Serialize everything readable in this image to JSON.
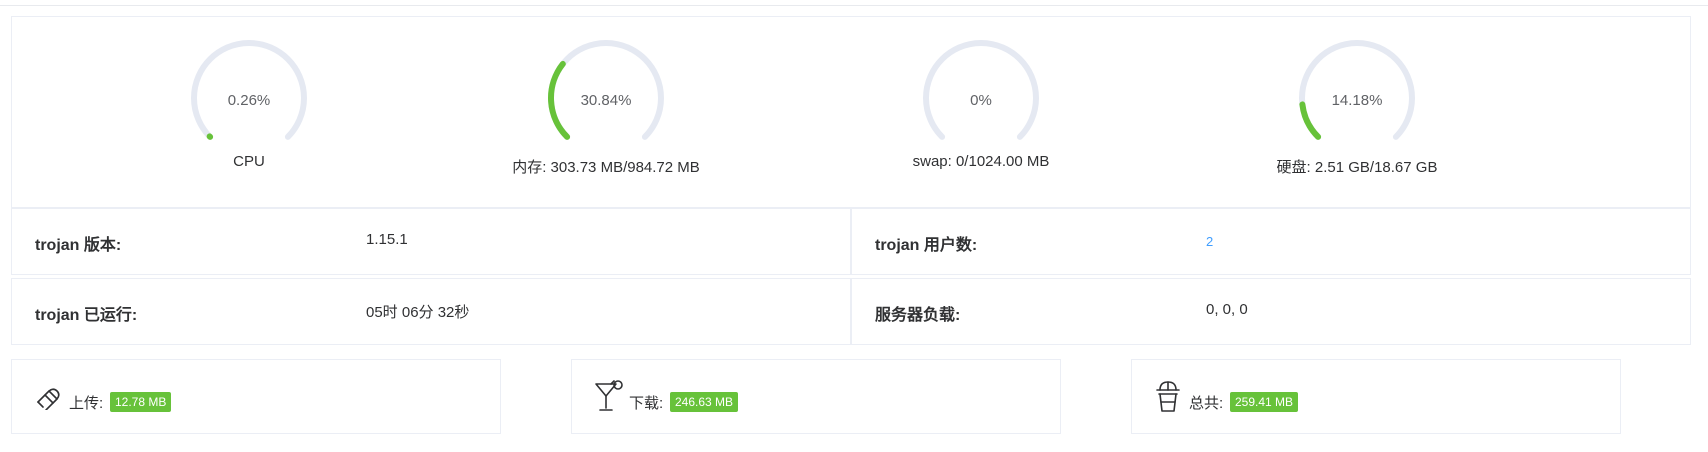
{
  "gauges": [
    {
      "id": "cpu",
      "value_text": "0.26%",
      "percent": 0.26,
      "label": "CPU"
    },
    {
      "id": "memory",
      "value_text": "30.84%",
      "percent": 30.84,
      "label": "内存: 303.73 MB/984.72 MB"
    },
    {
      "id": "swap",
      "value_text": "0%",
      "percent": 0,
      "label": "swap: 0/1024.00 MB"
    },
    {
      "id": "disk",
      "value_text": "14.18%",
      "percent": 14.18,
      "label": "硬盘: 2.51 GB/18.67 GB"
    }
  ],
  "colors": {
    "gauge_track": "#e5e9f2",
    "gauge_fill": "#67c23a",
    "badge": "#67c23a",
    "link": "#409eff"
  },
  "info": {
    "version_key": "trojan 版本:",
    "version_val": "1.15.1",
    "users_key": "trojan 用户数:",
    "users_val": "2",
    "uptime_key": "trojan 已运行:",
    "uptime_val": "05时 06分 32秒",
    "load_key": "服务器负载:",
    "load_val": "0, 0, 0"
  },
  "traffic": [
    {
      "icon": "upload-icon",
      "label": "上传:",
      "value": "12.78 MB"
    },
    {
      "icon": "download-icon",
      "label": "下载:",
      "value": "246.63 MB"
    },
    {
      "icon": "total-icon",
      "label": "总共:",
      "value": "259.41 MB"
    }
  ]
}
